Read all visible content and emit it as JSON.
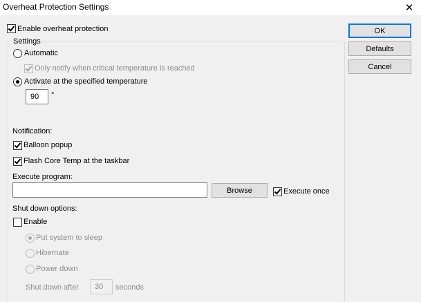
{
  "window": {
    "title": "Overheat Protection Settings",
    "close_glyph": "✕"
  },
  "enable_overheat": {
    "label": "Enable overheat protection",
    "checked": true
  },
  "settings_group": {
    "legend": "Settings",
    "automatic": {
      "label": "Automatic",
      "selected": false
    },
    "only_notify": {
      "label": "Only notify when critical temperature is reached",
      "checked": true,
      "enabled": false
    },
    "activate_specified": {
      "label": "Activate at the specified temperature",
      "selected": true
    },
    "temperature": {
      "value": "90",
      "unit": "°"
    },
    "notification": {
      "heading": "Notification:",
      "balloon_popup": {
        "label": "Balloon popup",
        "checked": true
      },
      "flash_taskbar": {
        "label": "Flash Core Temp at the taskbar",
        "checked": true
      }
    },
    "execute_program": {
      "heading": "Execute program:",
      "path_value": "",
      "browse_label": "Browse",
      "execute_once": {
        "label": "Execute once",
        "checked": true
      }
    },
    "shutdown": {
      "heading": "Shut down options:",
      "enable": {
        "label": "Enable",
        "checked": false
      },
      "sleep": {
        "label": "Put system to sleep",
        "selected": true
      },
      "hibernate": {
        "label": "Hibernate",
        "selected": false
      },
      "power_down": {
        "label": "Power down",
        "selected": false
      },
      "after_label": "Shut down after",
      "after_value": "30",
      "after_unit": "seconds"
    }
  },
  "buttons": {
    "ok": "OK",
    "defaults": "Defaults",
    "cancel": "Cancel"
  },
  "colors": {
    "window_bg": "#f0f0f0",
    "default_button_border": "#0078d7",
    "disabled_text": "#8c8c8c"
  }
}
